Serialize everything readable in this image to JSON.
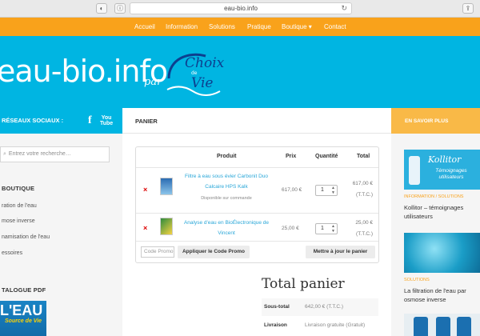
{
  "browser": {
    "url": "eau-bio.info"
  },
  "nav": {
    "items": [
      {
        "label": "Accueil"
      },
      {
        "label": "Information"
      },
      {
        "label": "Solutions"
      },
      {
        "label": "Pratique"
      },
      {
        "label": "Boutique ▾"
      },
      {
        "label": "Contact"
      }
    ],
    "accent": "#f9a21b"
  },
  "banner": {
    "site_name": "eau-bio.info",
    "par": "par",
    "logo_line1": "Choix",
    "logo_line2": "de",
    "logo_line3": "Vie",
    "color": "#00b5e2"
  },
  "left_sidebar": {
    "social_title": "RÉSEAUX SOCIAUX :",
    "facebook_glyph": "f",
    "youtube_line1": "You",
    "youtube_line2": "Tube",
    "search_placeholder": "Entrez votre recherche…",
    "boutique_title": "BOUTIQUE",
    "boutique_links": [
      {
        "label": "ration de l'eau"
      },
      {
        "label": "mose inverse"
      },
      {
        "label": "namisation de l'eau"
      },
      {
        "label": "essoires"
      }
    ],
    "catalog_title": "TALOGUE PDF",
    "catalog_big": "L'EAU",
    "catalog_sub": "Source de Vie"
  },
  "main": {
    "page_title": "PANIER",
    "cart": {
      "headers": {
        "product": "Produit",
        "price": "Prix",
        "quantity": "Quantité",
        "total": "Total"
      },
      "items": [
        {
          "remove": "×",
          "name": "Filtre à eau sous évier Carbonit Duo Calcaire HPS Kalk",
          "note": "Disponible sur commande",
          "price": "617,00 €",
          "quantity": "1",
          "total": "617,00 €",
          "ttc": "(T.T.C.)"
        },
        {
          "remove": "×",
          "name": "Analyse d'eau en BioÉlectronique de Vincent",
          "note": "",
          "price": "25,00 €",
          "quantity": "1",
          "total": "25,00 €",
          "ttc": "(T.T.C.)"
        }
      ],
      "promo_placeholder": "Code Promo",
      "apply_label": "Appliquer le Code Promo",
      "update_label": "Mettre à jour le panier"
    },
    "totals": {
      "title": "Total panier",
      "subtotal_label": "Sous-total",
      "subtotal_value": "642,00 € (T.T.C.)",
      "shipping_label": "Livraison",
      "shipping_value": "Livraison gratuite (Gratuit)"
    }
  },
  "right_sidebar": {
    "title": "EN SAVOIR PLUS",
    "post1": {
      "image_title": "Kollitor",
      "image_sub": "Témoignages utilisateurs",
      "category": "INFORMATION / SOLUTIONS",
      "title": "Kollitor – témoignages utilisateurs"
    },
    "post2": {
      "category": "SOLUTIONS",
      "title": "La filtration de l'eau par osmose inverse"
    }
  }
}
